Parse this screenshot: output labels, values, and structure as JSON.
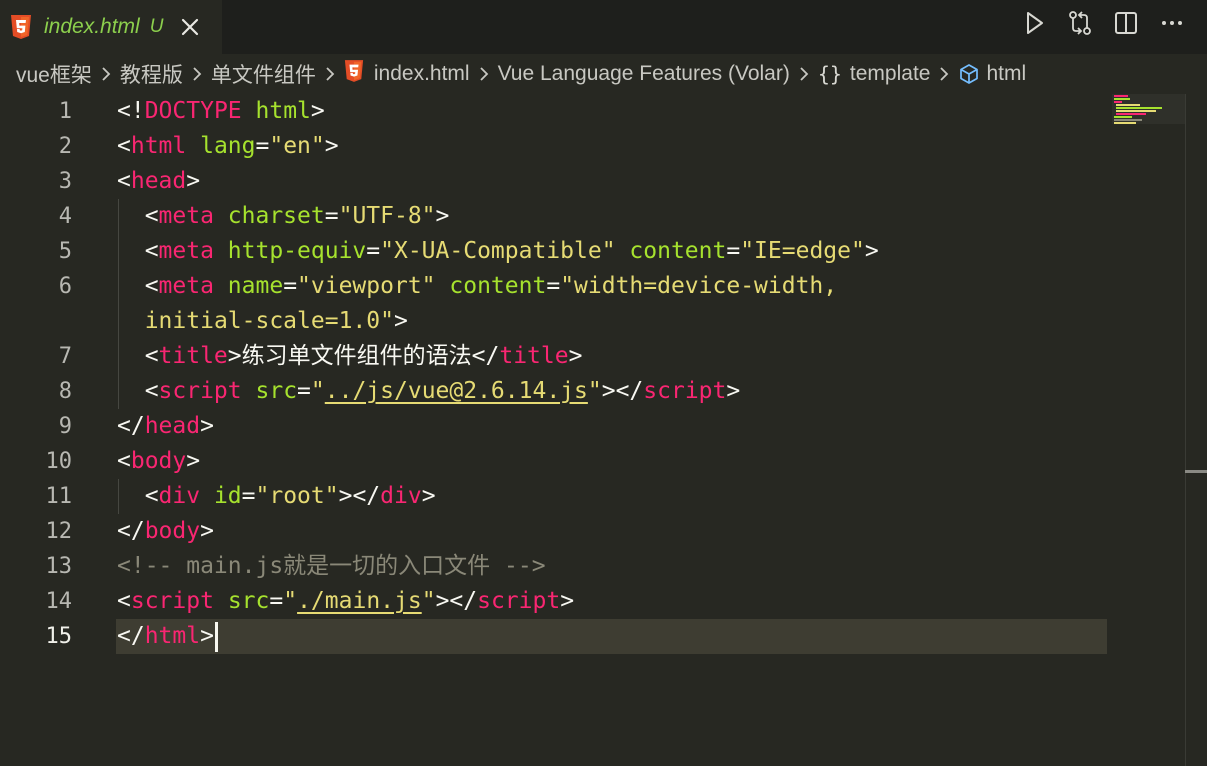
{
  "tab": {
    "icon": "html5-icon",
    "title": "index.html",
    "status": "U",
    "close_icon": "close-icon"
  },
  "actions": [
    {
      "name": "run-button",
      "icon": "play-icon"
    },
    {
      "name": "source-control-button",
      "icon": "compare-changes-icon"
    },
    {
      "name": "split-editor-button",
      "icon": "split-editor-icon"
    },
    {
      "name": "more-actions-button",
      "icon": "more-icon"
    }
  ],
  "breadcrumb": {
    "items": [
      "vue框架",
      "教程版",
      "单文件组件",
      "index.html",
      "Vue Language Features (Volar)",
      "template",
      "html"
    ]
  },
  "editor": {
    "line_numbers": [
      "1",
      "2",
      "3",
      "4",
      "5",
      "6",
      "",
      "7",
      "8",
      "9",
      "10",
      "11",
      "12",
      "13",
      "14",
      "15"
    ],
    "current_line": "15",
    "doctype": "DOCTYPE",
    "html_word": "html",
    "lang_attr": "lang",
    "lang_val": "\"en\"",
    "head": "head",
    "meta": "meta",
    "charset_attr": "charset",
    "charset_val": "\"UTF-8\"",
    "httpequiv_attr": "http-equiv",
    "httpequiv_val": "\"X-UA-Compatible\"",
    "content_attr": "content",
    "content_val_1": "\"IE=edge\"",
    "name_attr": "name",
    "name_val": "\"viewport\"",
    "content_val_2a": "\"width=device-width,",
    "content_val_2b": "initial-scale=1.0\"",
    "title": "title",
    "title_text": "练习单文件组件的语法",
    "script": "script",
    "src_attr": "src",
    "src_val_1": "../js/vue@2.6.14.js",
    "body": "body",
    "div": "div",
    "id_attr": "id",
    "id_val": "\"root\"",
    "comment": "<!-- main.js就是一切的入口文件 -->",
    "src_val_2": "./main.js"
  },
  "colors": {
    "background": "#272822",
    "tag": "#f92672",
    "attribute": "#a6e22e",
    "string": "#e6db74",
    "comment": "#8a8878",
    "tab_title": "#8ccf4d"
  }
}
